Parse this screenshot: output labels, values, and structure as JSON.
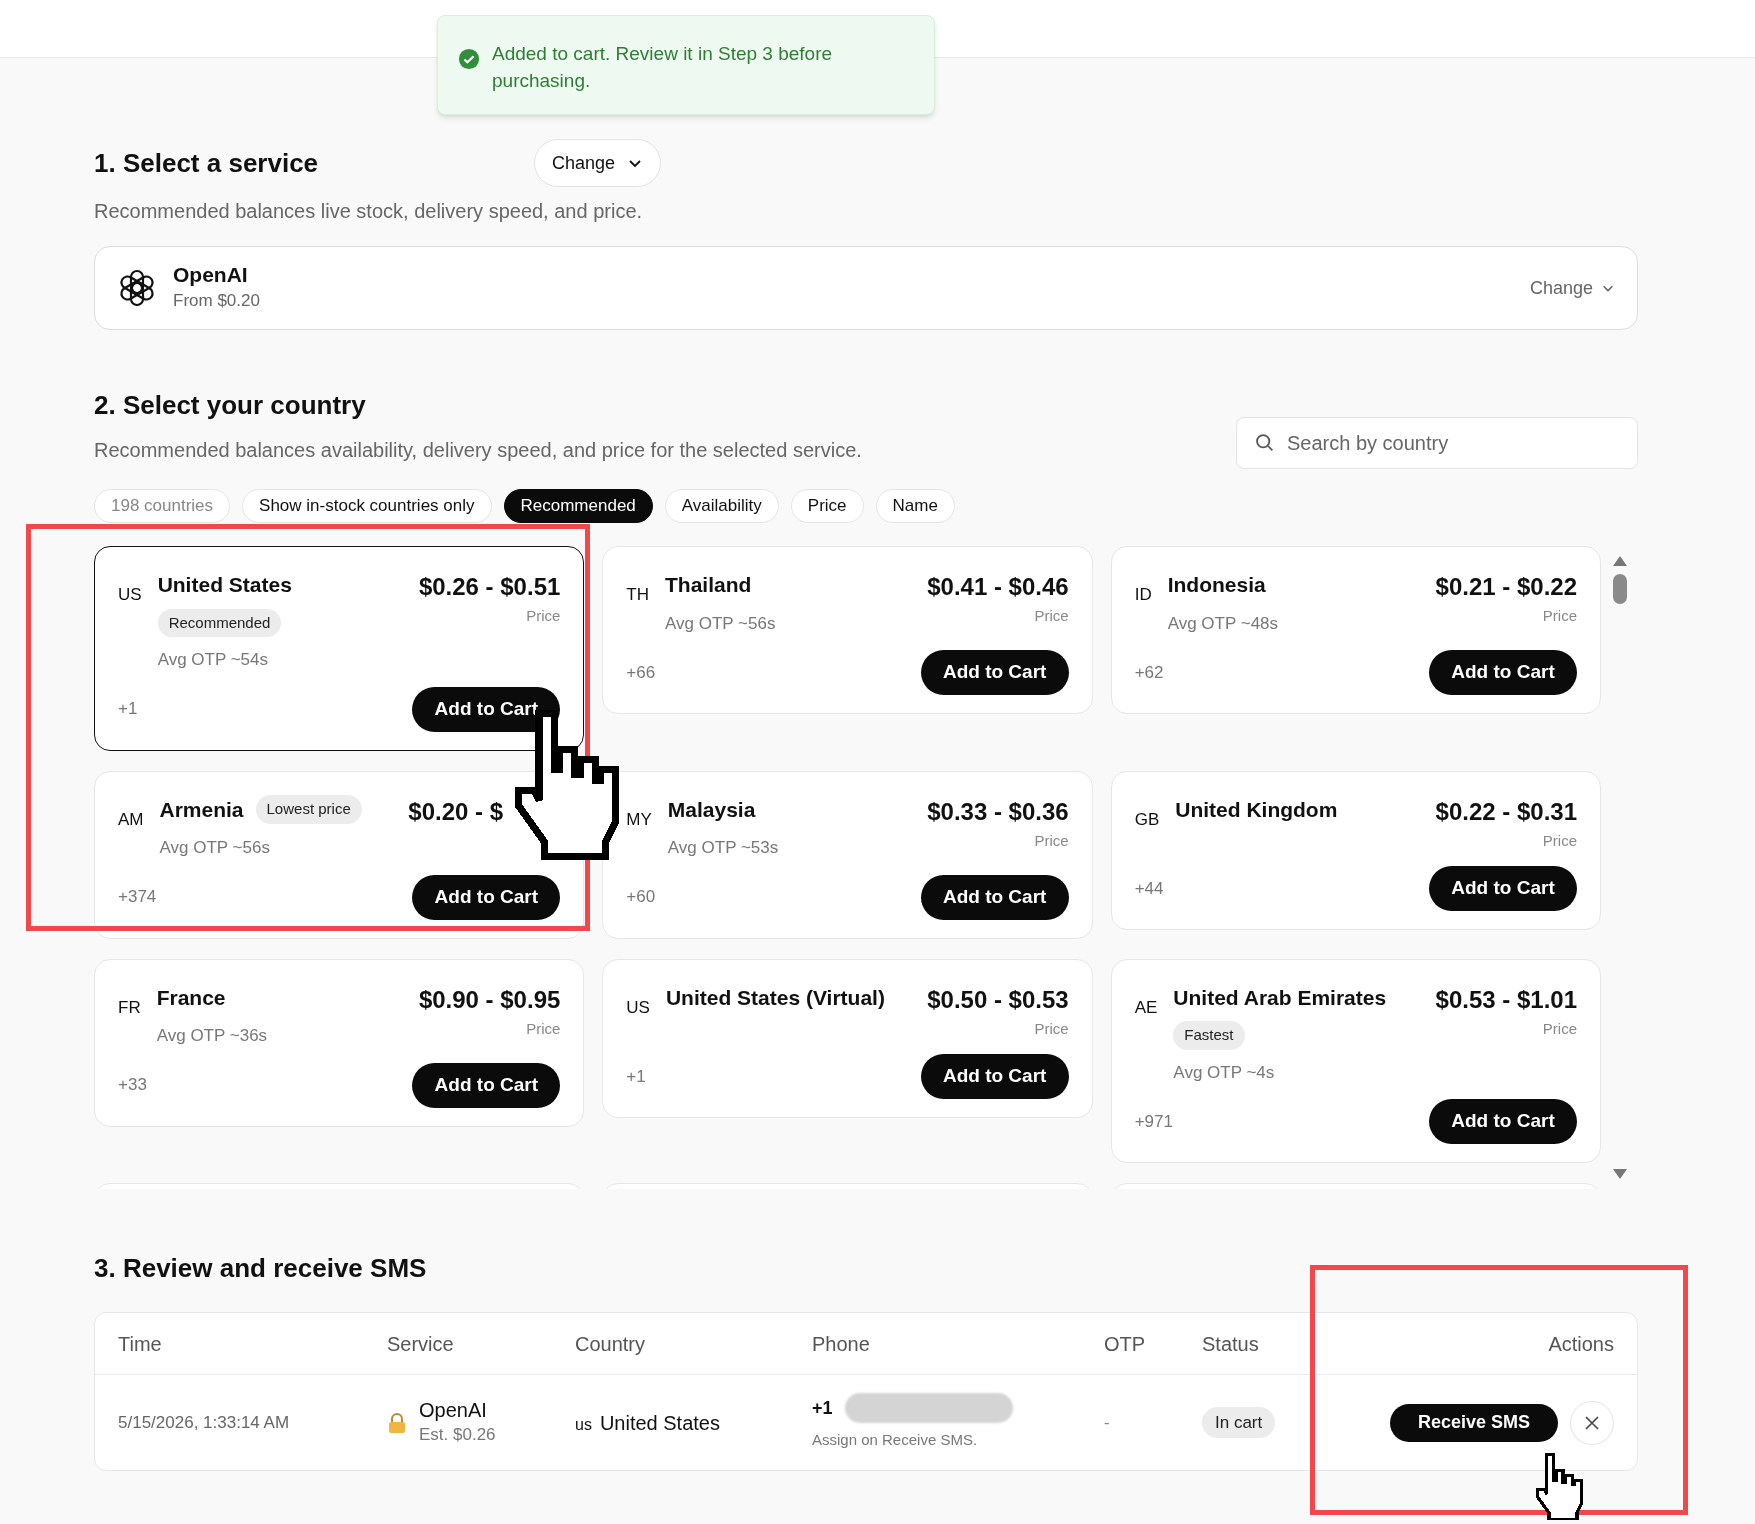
{
  "toast": {
    "text": "Added to cart. Review it in Step 3 before purchasing."
  },
  "service_section": {
    "title": "1. Select a service",
    "change_button": "Change",
    "subtitle": "Recommended balances live stock, delivery speed, and price.",
    "service": {
      "name": "OpenAI",
      "price": "From $0.20",
      "change": "Change"
    }
  },
  "country_section": {
    "title": "2. Select your country",
    "subtitle": "Recommended balances availability, delivery speed, and price for the selected service.",
    "search": {
      "placeholder": "Search by country"
    },
    "count": "198 countries",
    "stock_filter": {
      "label": "Show in-stock countries only",
      "on": false
    },
    "sorts": [
      {
        "label": "Recommended",
        "selected": true
      },
      {
        "label": "Availability",
        "selected": false
      },
      {
        "label": "Price",
        "selected": false
      },
      {
        "label": "Name",
        "selected": false
      }
    ],
    "countries": [
      {
        "code": "US",
        "name": "United States",
        "badge": "Recommended",
        "avg_otp": "Avg OTP ~54s",
        "dial": "+1",
        "price": "$0.26 - $0.51",
        "price_label": "Price",
        "button": "Add to Cart",
        "selected": true
      },
      {
        "code": "TH",
        "name": "Thailand",
        "avg_otp": "Avg OTP ~56s",
        "dial": "+66",
        "price": "$0.41 - $0.46",
        "price_label": "Price",
        "button": "Add to Cart",
        "selected": false
      },
      {
        "code": "ID",
        "name": "Indonesia",
        "avg_otp": "Avg OTP ~48s",
        "dial": "+62",
        "price": "$0.21 - $0.22",
        "price_label": "Price",
        "button": "Add to Cart",
        "selected": false
      },
      {
        "code": "AM",
        "name": "Armenia",
        "badge": "Lowest price",
        "avg_otp": "Avg OTP ~56s",
        "dial": "+374",
        "price": "$0.20 - $",
        "button": "Add to Cart",
        "selected": false
      },
      {
        "code": "MY",
        "name": "Malaysia",
        "avg_otp": "Avg OTP ~53s",
        "dial": "+60",
        "price": "$0.33 - $0.36",
        "price_label": "Price",
        "button": "Add to Cart",
        "selected": false
      },
      {
        "code": "GB",
        "name": "United Kingdom",
        "dial": "+44",
        "price": "$0.22 - $0.31",
        "price_label": "Price",
        "button": "Add to Cart",
        "selected": false
      },
      {
        "code": "FR",
        "name": "France",
        "avg_otp": "Avg OTP ~36s",
        "dial": "+33",
        "price": "$0.90 - $0.95",
        "price_label": "Price",
        "button": "Add to Cart",
        "selected": false
      },
      {
        "code": "US",
        "name": "United States (Virtual)",
        "dial": "+1",
        "price": "$0.50 - $0.53",
        "price_label": "Price",
        "button": "Add to Cart",
        "selected": false
      },
      {
        "code": "AE",
        "name": "United Arab Emirates",
        "badge": "Fastest",
        "avg_otp": "Avg OTP ~4s",
        "dial": "+971",
        "price": "$0.53 - $1.01",
        "price_label": "Price",
        "button": "Add to Cart",
        "selected": false
      }
    ]
  },
  "review_section": {
    "title": "3. Review and receive SMS",
    "columns": [
      "Time",
      "Service",
      "Country",
      "Phone",
      "OTP",
      "Status",
      "Actions"
    ],
    "rows": [
      {
        "time": "5/15/2026, 1:33:14 AM",
        "service": "OpenAI",
        "estimate": "Est. $0.26",
        "country_code": "us",
        "country": "United States",
        "phone_prefix": "+1",
        "phone_note": "Assign on Receive SMS.",
        "otp": "-",
        "status": "In cart",
        "action": "Receive SMS"
      }
    ]
  }
}
